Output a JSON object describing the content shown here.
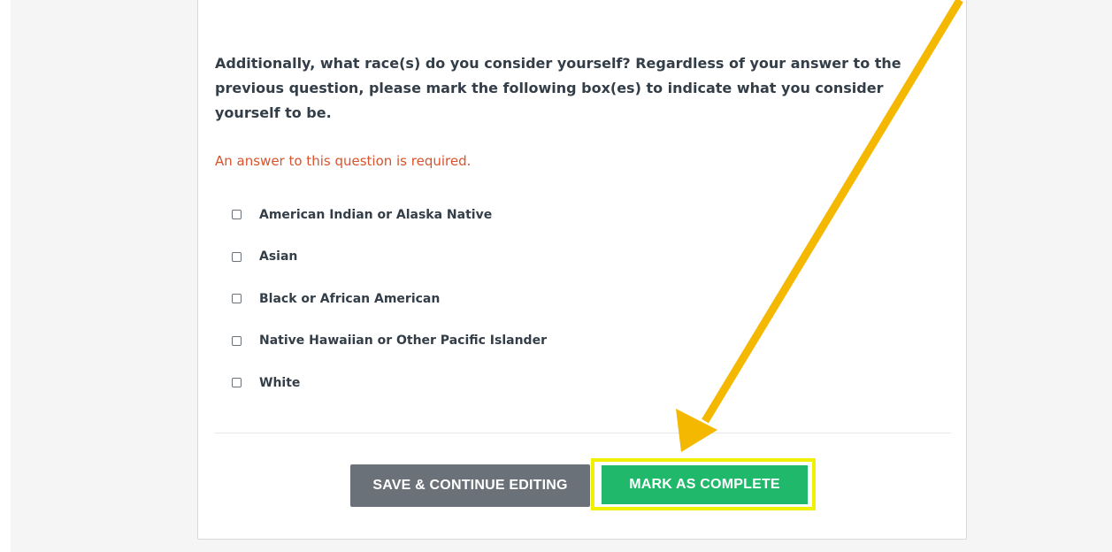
{
  "question": {
    "text": "Additionally, what race(s) do you consider yourself? Regardless of your answer to the previous question, please mark the following box(es) to indicate what you consider yourself to be.",
    "required_message": "An answer to this question is required."
  },
  "options": [
    {
      "label": "American Indian or Alaska Native",
      "checked": false
    },
    {
      "label": "Asian",
      "checked": false
    },
    {
      "label": "Black or African American",
      "checked": false
    },
    {
      "label": "Native Hawaiian or Other Pacific Islander",
      "checked": false
    },
    {
      "label": "White",
      "checked": false
    }
  ],
  "buttons": {
    "save_label": "SAVE & CONTINUE EDITING",
    "complete_label": "MARK AS COMPLETE"
  },
  "colors": {
    "required_text": "#d9532c",
    "save_button": "#6b7178",
    "complete_button": "#20b86b",
    "highlight_box": "#f0f000",
    "annotation_arrow": "#f5b800"
  },
  "annotation": {
    "icon": "pointer-arrow-icon"
  }
}
